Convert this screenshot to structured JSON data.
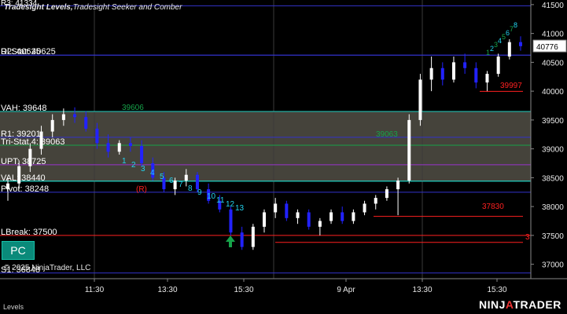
{
  "header": {
    "title_bold": "Tradesight Levels,",
    "title_rest": "Tradesight Seeker and Comber",
    "cut_label": "R3: 41334"
  },
  "footer": {
    "copyright": "© 2025 NinjaTrader, LLC",
    "tab_label": "Levels",
    "brand_main": "NINJ",
    "brand_bar": "A",
    "brand_end": "TRADER"
  },
  "badge": {
    "label": "PC"
  },
  "colors": {
    "background": "#000000",
    "level_line": "#3333cc",
    "value_area_fill": "#4d4a41",
    "value_area_edge": "#20d0c0",
    "candle": "#ffffff",
    "candle_down": "#2222ff",
    "red": "#ff2020",
    "seeker_green": "#16a34a",
    "comber_cyan": "#22d3ee",
    "axis_text": "#e8e8e8"
  },
  "chart_data": {
    "type": "candlestick",
    "ylim": [
      36750,
      41580
    ],
    "price_ticks": [
      41500,
      41000,
      40500,
      40000,
      39500,
      39000,
      38500,
      38000,
      37500,
      37000
    ],
    "time_ticks": [
      "11:30",
      "13:30",
      "15:30",
      "9 Apr",
      "13:30",
      "15:30"
    ],
    "last_price": "40776",
    "levels": [
      {
        "name": "R2",
        "label": "R2: 40625",
        "value": 40625
      },
      {
        "name": "Di Stat",
        "label": "Di Stat: 40625",
        "value": 40625
      },
      {
        "name": "VAH",
        "label": "VAH: 39648",
        "value": 39648
      },
      {
        "name": "R1",
        "label": "R1: 39201",
        "value": 39201
      },
      {
        "name": "Tri-Stat",
        "label": "Tri-Stat 4: 39063",
        "value": 39063
      },
      {
        "name": "UPT",
        "label": "UPT: 38725",
        "value": 38725
      },
      {
        "name": "VAL",
        "label": "VAL: 38440",
        "value": 38440
      },
      {
        "name": "Pivot",
        "label": "Pivot: 38248",
        "value": 38248
      },
      {
        "name": "LBreak",
        "label": "LBreak: 37500",
        "value": 37500
      },
      {
        "name": "S1",
        "label": "S1: 36848",
        "value": 36848
      }
    ],
    "value_area": {
      "high": 39648,
      "low": 38440
    },
    "annotations": [
      {
        "text": "39606",
        "color": "#16a34a",
        "value": 39606
      },
      {
        "text": "39063",
        "color": "#16a34a",
        "value": 39063
      },
      {
        "text": "37830",
        "color": "#ff2020",
        "value": 37830
      },
      {
        "text": "39997",
        "color": "#ff2020",
        "value": 39997
      },
      {
        "text": "3",
        "color": "#ff2020",
        "value": 37380
      },
      {
        "text": "(R)",
        "color": "#ff2020",
        "value": 38150
      }
    ],
    "seeker_labels": [
      "1",
      "2",
      "3",
      "4",
      "5",
      "6",
      "7",
      "8",
      "9",
      "10",
      "11",
      "12",
      "13"
    ],
    "comber_labels": [
      "1",
      "2",
      "3",
      "4",
      "5",
      "6",
      "7",
      "8"
    ],
    "candles": [
      {
        "o": 38300,
        "h": 38500,
        "l": 38100,
        "c": 38400
      },
      {
        "o": 38400,
        "h": 38800,
        "l": 38300,
        "c": 38700
      },
      {
        "o": 38700,
        "h": 39100,
        "l": 38600,
        "c": 39000
      },
      {
        "o": 39000,
        "h": 39400,
        "l": 38900,
        "c": 39300
      },
      {
        "o": 39300,
        "h": 39600,
        "l": 39200,
        "c": 39500
      },
      {
        "o": 39500,
        "h": 39700,
        "l": 39400,
        "c": 39600
      },
      {
        "o": 39600,
        "h": 39720,
        "l": 39450,
        "c": 39550
      },
      {
        "o": 39550,
        "h": 39650,
        "l": 39300,
        "c": 39350
      },
      {
        "o": 39350,
        "h": 39450,
        "l": 39000,
        "c": 39100
      },
      {
        "o": 39100,
        "h": 39250,
        "l": 38850,
        "c": 38950
      },
      {
        "o": 38950,
        "h": 39150,
        "l": 38900,
        "c": 39100
      },
      {
        "o": 39100,
        "h": 39200,
        "l": 38950,
        "c": 39050
      },
      {
        "o": 39050,
        "h": 39150,
        "l": 38700,
        "c": 38750
      },
      {
        "o": 38750,
        "h": 38850,
        "l": 38450,
        "c": 38500
      },
      {
        "o": 38500,
        "h": 38600,
        "l": 38250,
        "c": 38300
      },
      {
        "o": 38300,
        "h": 38500,
        "l": 38200,
        "c": 38450
      },
      {
        "o": 38450,
        "h": 38650,
        "l": 38350,
        "c": 38550
      },
      {
        "o": 38550,
        "h": 38600,
        "l": 38250,
        "c": 38300
      },
      {
        "o": 38300,
        "h": 38400,
        "l": 38050,
        "c": 38100
      },
      {
        "o": 38100,
        "h": 38200,
        "l": 37900,
        "c": 37950
      },
      {
        "o": 37950,
        "h": 38000,
        "l": 37500,
        "c": 37550
      },
      {
        "o": 37550,
        "h": 37650,
        "l": 37250,
        "c": 37300
      },
      {
        "o": 37300,
        "h": 37700,
        "l": 37250,
        "c": 37650
      },
      {
        "o": 37650,
        "h": 37950,
        "l": 37550,
        "c": 37900
      },
      {
        "o": 37900,
        "h": 38150,
        "l": 37800,
        "c": 38050
      },
      {
        "o": 38050,
        "h": 38100,
        "l": 37750,
        "c": 37800
      },
      {
        "o": 37800,
        "h": 37950,
        "l": 37700,
        "c": 37900
      },
      {
        "o": 37900,
        "h": 37950,
        "l": 37600,
        "c": 37650
      },
      {
        "o": 37650,
        "h": 37800,
        "l": 37500,
        "c": 37750
      },
      {
        "o": 37750,
        "h": 37950,
        "l": 37700,
        "c": 37900
      },
      {
        "o": 37900,
        "h": 38000,
        "l": 37700,
        "c": 37750
      },
      {
        "o": 37750,
        "h": 37950,
        "l": 37700,
        "c": 37900
      },
      {
        "o": 37900,
        "h": 38100,
        "l": 37850,
        "c": 38050
      },
      {
        "o": 38050,
        "h": 38200,
        "l": 37950,
        "c": 38150
      },
      {
        "o": 38150,
        "h": 38350,
        "l": 38100,
        "c": 38300
      },
      {
        "o": 38300,
        "h": 38500,
        "l": 37850,
        "c": 38450
      },
      {
        "o": 38450,
        "h": 39600,
        "l": 38400,
        "c": 39500
      },
      {
        "o": 39500,
        "h": 40300,
        "l": 39400,
        "c": 40200
      },
      {
        "o": 40200,
        "h": 40600,
        "l": 40000,
        "c": 40400
      },
      {
        "o": 40400,
        "h": 40500,
        "l": 40100,
        "c": 40200
      },
      {
        "o": 40200,
        "h": 40600,
        "l": 40150,
        "c": 40500
      },
      {
        "o": 40500,
        "h": 40650,
        "l": 40300,
        "c": 40400
      },
      {
        "o": 40400,
        "h": 40500,
        "l": 40050,
        "c": 40150
      },
      {
        "o": 40150,
        "h": 40350,
        "l": 39990,
        "c": 40300
      },
      {
        "o": 40300,
        "h": 40650,
        "l": 40250,
        "c": 40600
      },
      {
        "o": 40600,
        "h": 40900,
        "l": 40550,
        "c": 40850
      },
      {
        "o": 40850,
        "h": 40950,
        "l": 40700,
        "c": 40780
      }
    ]
  }
}
